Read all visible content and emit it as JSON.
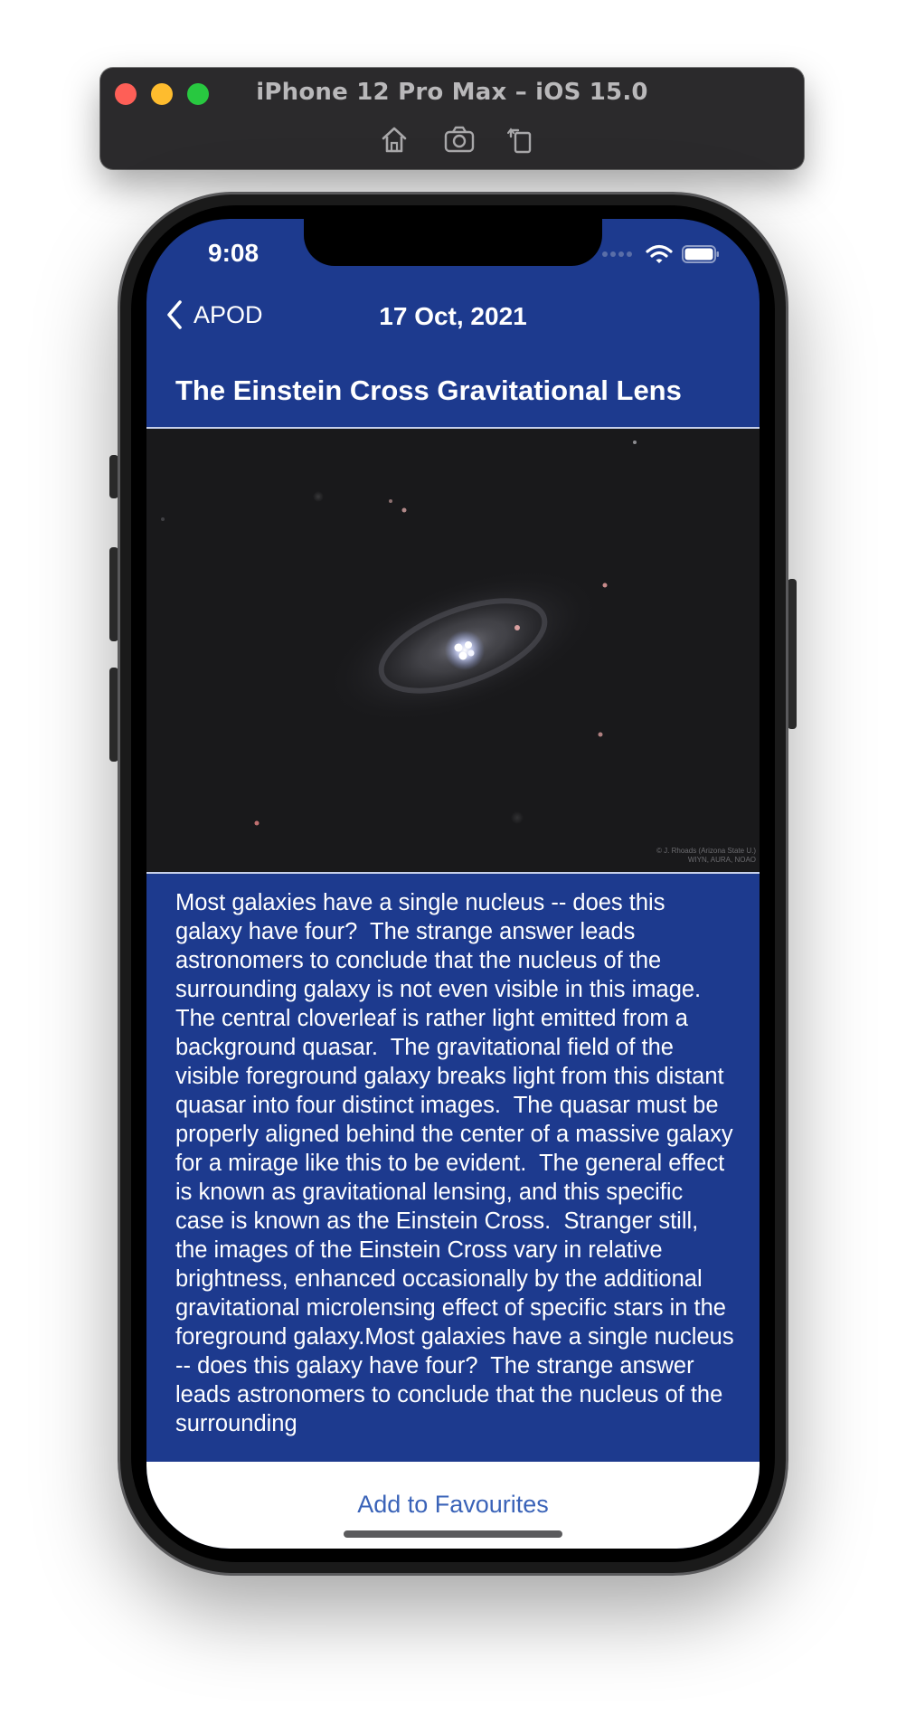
{
  "simulator": {
    "title": "iPhone 12 Pro Max – iOS 15.0",
    "tools": [
      "home-icon",
      "camera-icon",
      "rotate-icon"
    ]
  },
  "status_bar": {
    "time": "9:08"
  },
  "navbar": {
    "back_label": "APOD",
    "title": "17 Oct, 2021"
  },
  "article": {
    "title": "The Einstein Cross Gravitational Lens",
    "image_credit": "© J. Rhoads (Arizona State U.)\nWIYN, AURA, NOAO",
    "explanation": "Most galaxies have a single nucleus -- does this galaxy have four?  The strange answer leads astronomers to conclude that the nucleus of the surrounding galaxy is not even visible in this image.  The central cloverleaf is rather light emitted from a background quasar.  The gravitational field of the visible foreground galaxy breaks light from this distant quasar into four distinct images.  The quasar must be properly aligned behind the center of a massive galaxy for a mirage like this to be evident.  The general effect is known as gravitational lensing, and this specific case is known as the Einstein Cross.  Stranger still, the images of the Einstein Cross vary in relative brightness, enhanced occasionally by the additional gravitational microlensing effect of specific stars in the foreground galaxy.Most galaxies have a single nucleus -- does this galaxy have four?  The strange answer leads astronomers to conclude that the nucleus of the surrounding"
  },
  "actions": {
    "favourite_label": "Add to Favourites"
  },
  "colors": {
    "navy": "#1d3a8e",
    "link": "#3a63b8"
  }
}
